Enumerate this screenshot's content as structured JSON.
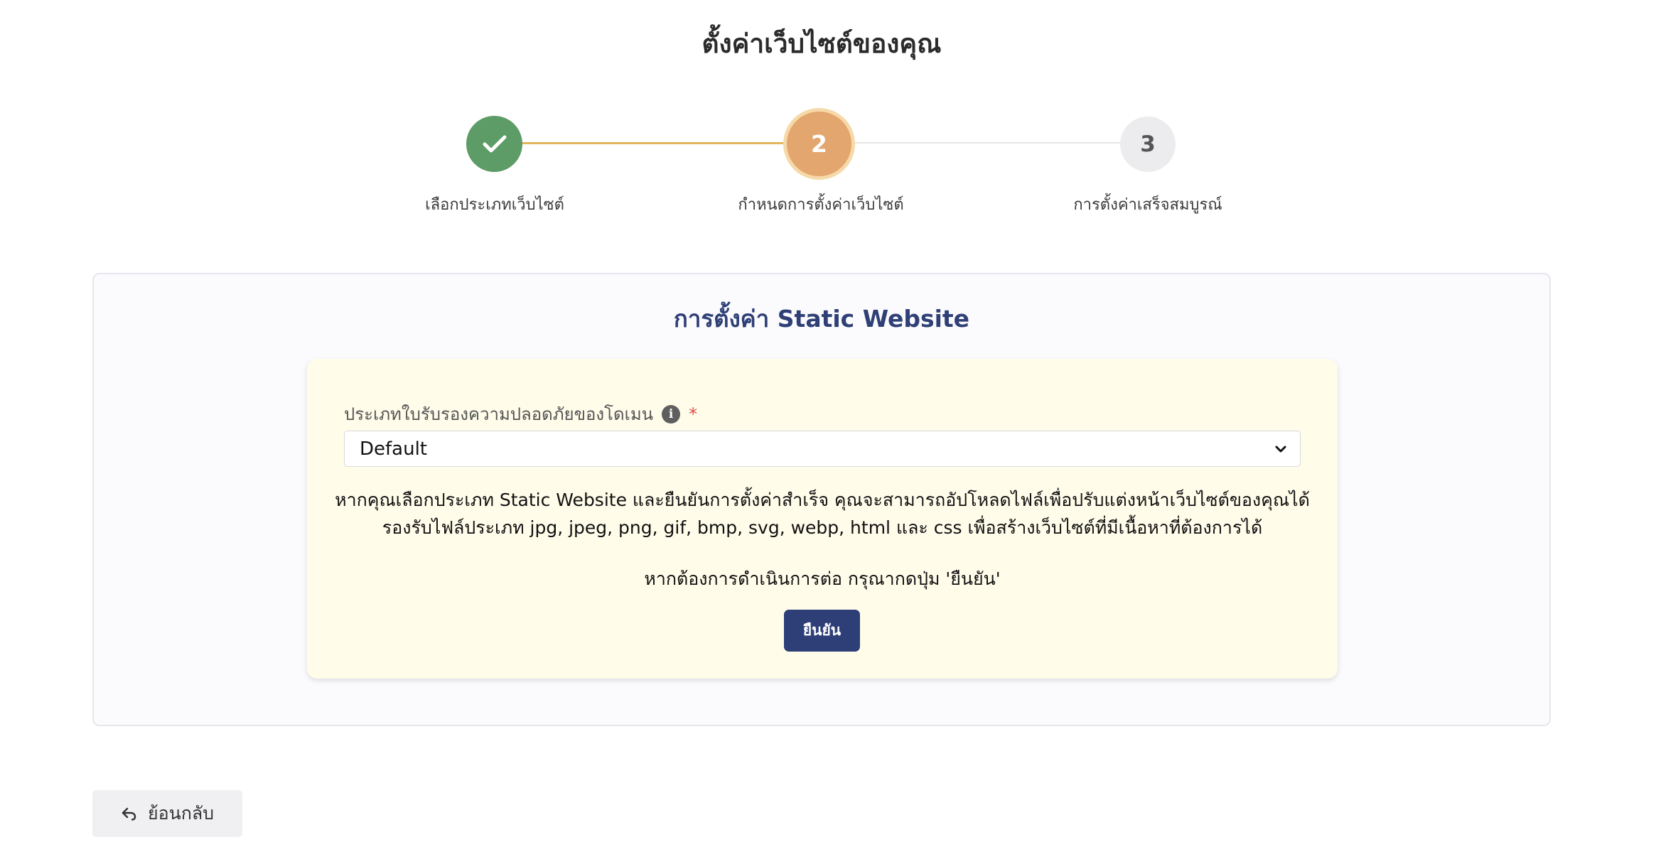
{
  "page": {
    "title": "ตั้งค่าเว็บไซต์ของคุณ"
  },
  "stepper": {
    "steps": [
      {
        "number": "1",
        "label": "เลือกประเภทเว็บไซต์",
        "status": "completed",
        "icon": "check-icon"
      },
      {
        "number": "2",
        "label": "กำหนดการตั้งค่าเว็บไซต์",
        "status": "active"
      },
      {
        "number": "3",
        "label": "การตั้งค่าเสร็จสมบูรณ์",
        "status": "pending"
      }
    ]
  },
  "card": {
    "title": "การตั้งค่า Static Website",
    "field": {
      "label": "ประเภทใบรับรองความปลอดภัยของโดเมน",
      "required_mark": "*",
      "info_icon": "info-icon",
      "selected_value": "Default"
    },
    "description_line1": "หากคุณเลือกประเภท Static Website และยืนยันการตั้งค่าสำเร็จ คุณจะสามารถอัปโหลดไฟล์เพื่อปรับแต่งหน้าเว็บไซต์ของคุณได้",
    "description_line2": "รองรับไฟล์ประเภท jpg, jpeg, png, gif, bmp, svg, webp, html และ css เพื่อสร้างเว็บไซต์ที่มีเนื้อหาที่ต้องการได้",
    "instruction": "หากต้องการดำเนินการต่อ กรุณากดปุ่ม 'ยืนยัน'",
    "confirm_label": "ยืนยัน"
  },
  "footer": {
    "back_label": "ย้อนกลับ",
    "back_icon": "undo-arrow-icon"
  },
  "colors": {
    "completed": "#5d9c67",
    "active": "#e2a66e",
    "primary": "#2e3f78",
    "panel_bg": "#fffcea",
    "required": "#e04b4b"
  }
}
